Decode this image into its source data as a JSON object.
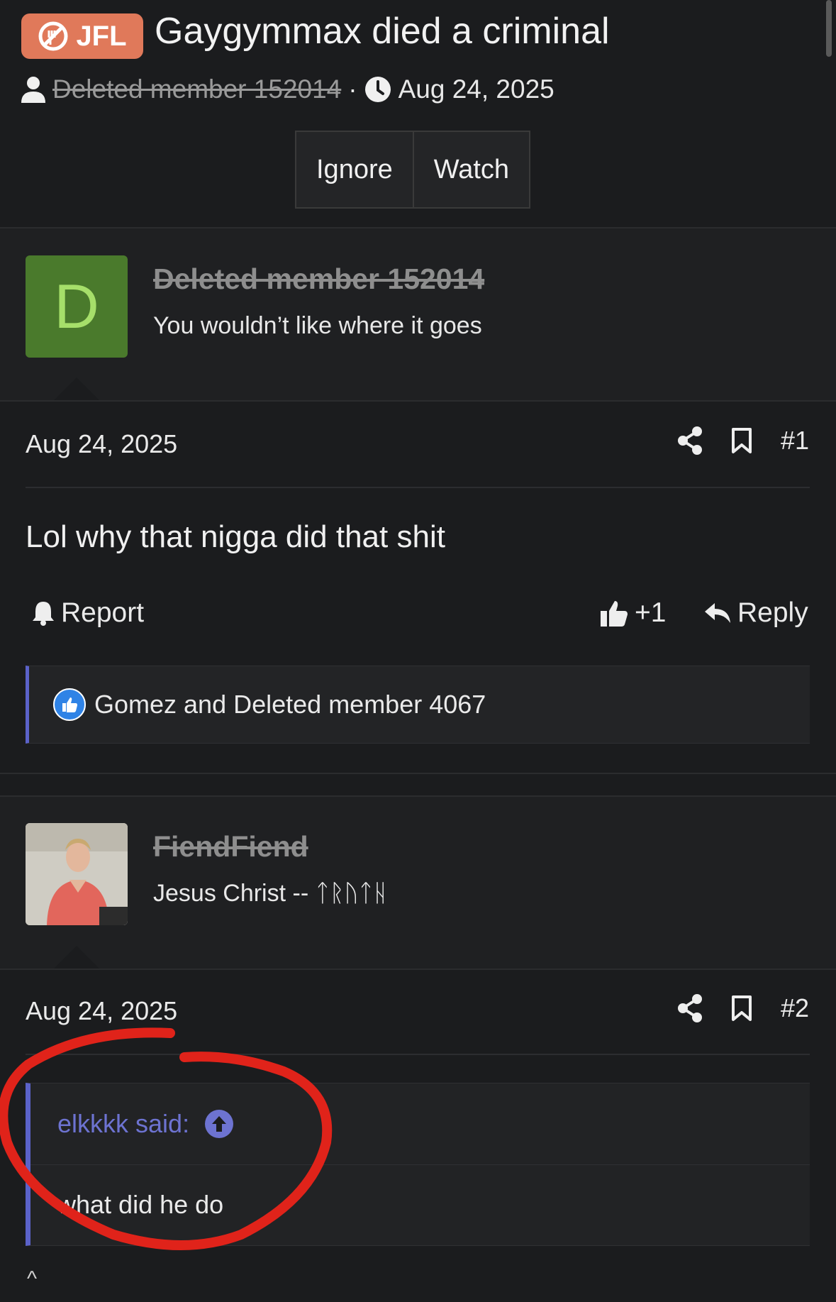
{
  "thread": {
    "prefix": "JFL",
    "title": "Gaygymmax died a criminal",
    "author": "Deleted member 152014",
    "separator": "·",
    "date": "Aug 24, 2025",
    "buttons": {
      "ignore": "Ignore",
      "watch": "Watch"
    }
  },
  "posts": [
    {
      "avatar_letter": "D",
      "username": "Deleted member 152014",
      "user_title": "You wouldn’t like where it goes",
      "date": "Aug 24, 2025",
      "number": "#1",
      "body": "Lol why that nigga did that shit",
      "report": "Report",
      "reaction_count": "+1",
      "reply": "Reply",
      "reactions": "Gomez and Deleted member 4067"
    },
    {
      "username": "FiendFiend",
      "user_title": "Jesus Christ -- ᛏᚱᚢᛏᚺ",
      "date": "Aug 24, 2025",
      "number": "#2",
      "quote_author": "elkkkk said:",
      "quote_text": "what did he do"
    }
  ],
  "caret": "^",
  "colors": {
    "accent": "#5b62c9",
    "prefix": "#e0795a",
    "annotation": "#e0231a"
  }
}
